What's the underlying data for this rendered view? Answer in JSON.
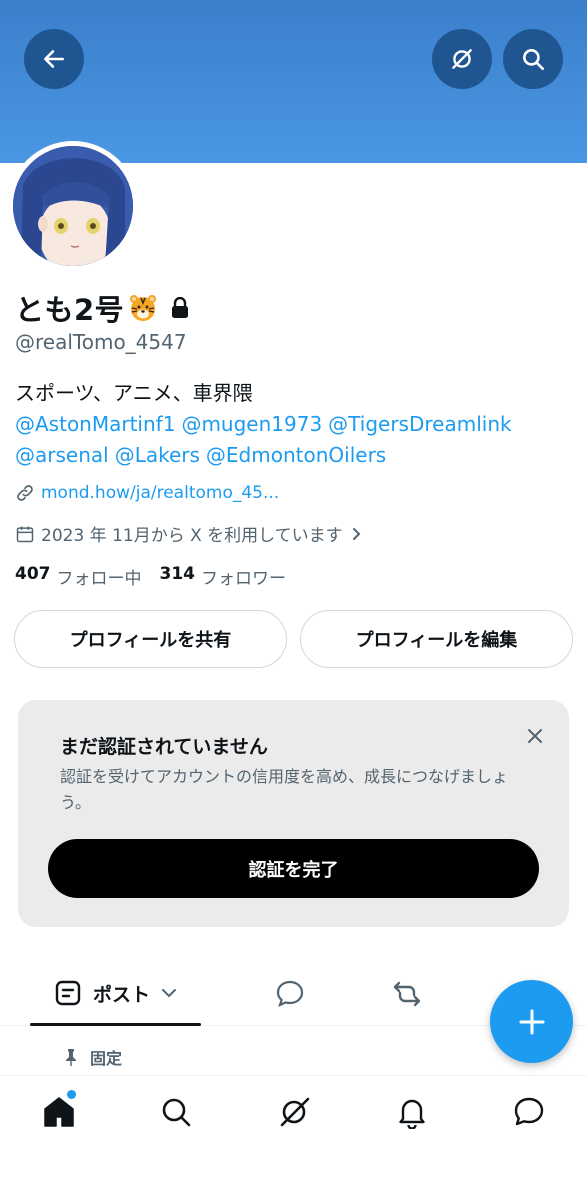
{
  "header": {
    "back_icon": "arrow-left-icon",
    "grok_icon": "grok-icon",
    "search_icon": "search-icon",
    "banner_color": "#4a97e3"
  },
  "profile": {
    "display_name": "とも2号",
    "name_emoji": "tiger-face-icon",
    "protected_icon": "lock-icon",
    "handle": "@realTomo_4547",
    "bio_text": "スポーツ、アニメ、車界隈",
    "bio_mentions_line1": [
      "@AstonMartinf1",
      "@mugen1973",
      "@TigersDreamlink"
    ],
    "bio_mentions_line2": [
      "@arsenal",
      "@Lakers",
      "@EdmontonOilers"
    ],
    "link": "mond.how/ja/realtomo_45...",
    "joined": "2023 年 11月から X を利用しています",
    "following_count": "407",
    "following_label": "フォロー中",
    "followers_count": "314",
    "followers_label": "フォロワー"
  },
  "actions": {
    "share_label": "プロフィールを共有",
    "edit_label": "プロフィールを編集"
  },
  "verify_card": {
    "title": "まだ認証されていません",
    "description": "認証を受けてアカウントの信用度を高め、成長につなげましょう。",
    "button_label": "認証を完了"
  },
  "tabs": {
    "posts_label": "ポスト"
  },
  "pinned": {
    "label": "固定"
  },
  "colors": {
    "accent": "#1d9bf0",
    "text": "#0f1419",
    "muted": "#536471"
  }
}
